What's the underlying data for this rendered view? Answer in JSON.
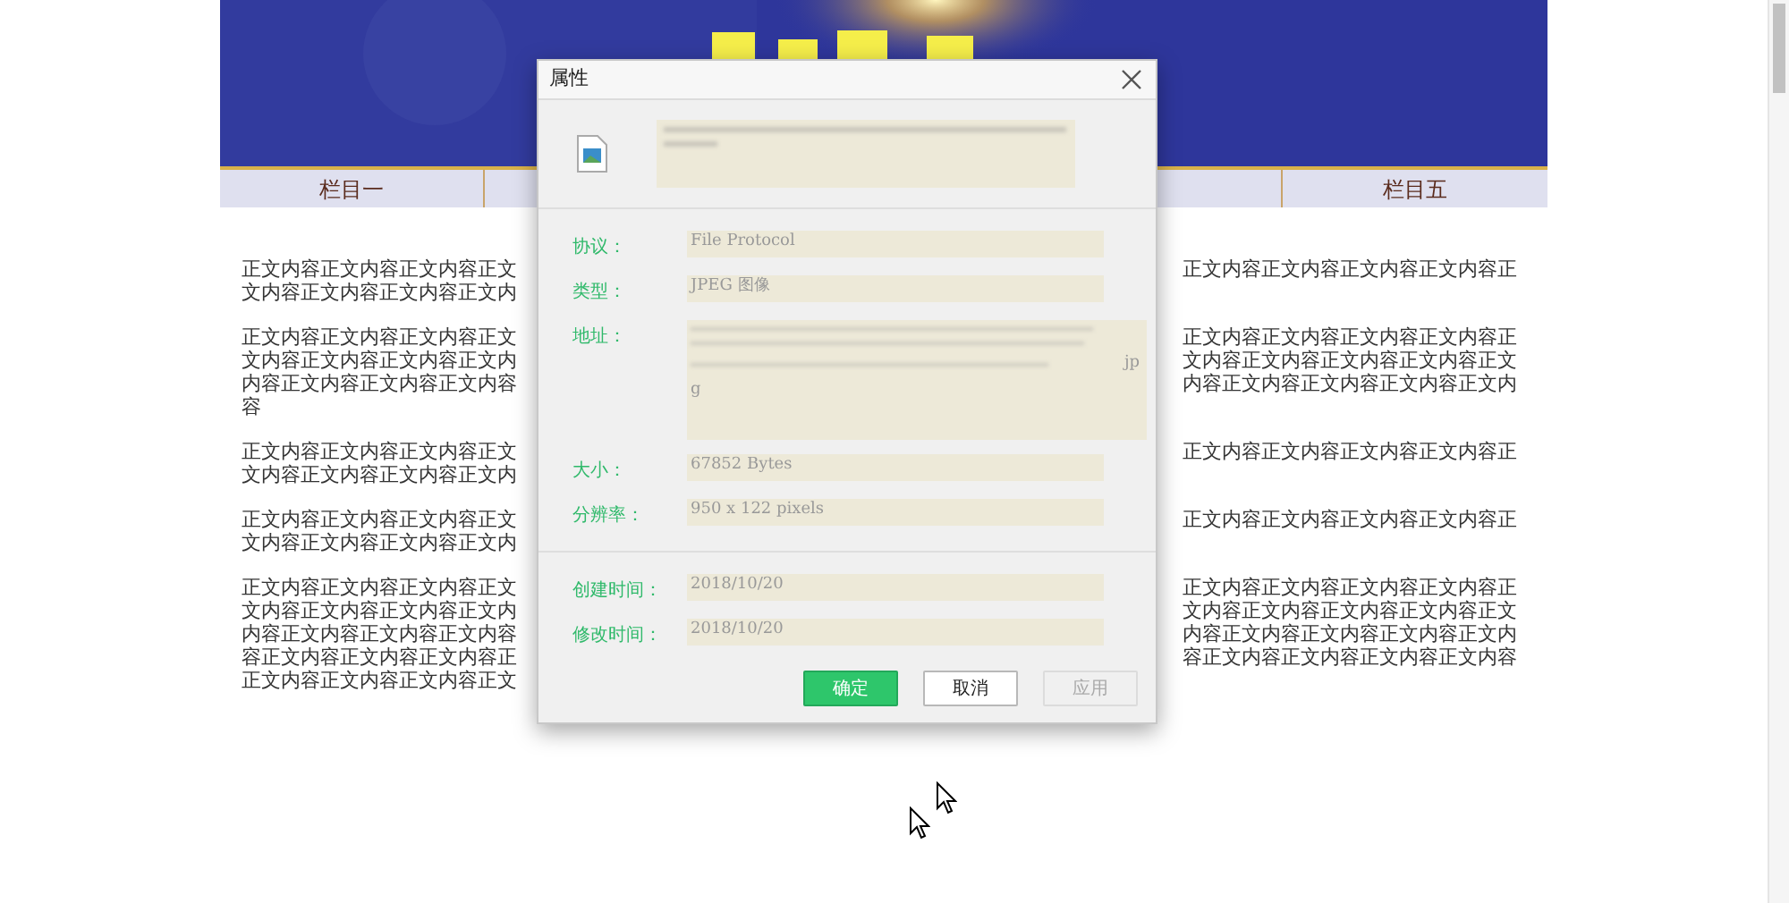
{
  "nav": {
    "items": [
      {
        "label": "栏目一"
      },
      {
        "label": "栏目五"
      }
    ]
  },
  "body": {
    "paragraphs": [
      {
        "lines": [
          {
            "left": "正文内容正文内容正文内容正文",
            "right": "正文内容正文内容正文内容正文内容正"
          },
          {
            "left": "文内容正文内容正文内容正文内"
          }
        ]
      },
      {
        "lines": [
          {
            "left": "正文内容正文内容正文内容正文",
            "right": "正文内容正文内容正文内容正文内容正"
          },
          {
            "left": "文内容正文内容正文内容正文内",
            "right": "文内容正文内容正文内容正文内容正文"
          },
          {
            "left": "内容正文内容正文内容正文内容",
            "right": "内容正文内容正文内容正文内容正文内"
          },
          {
            "left": "容"
          }
        ]
      },
      {
        "lines": [
          {
            "left": "正文内容正文内容正文内容正文",
            "right": "正文内容正文内容正文内容正文内容正"
          },
          {
            "left": "文内容正文内容正文内容正文内"
          }
        ]
      },
      {
        "lines": [
          {
            "left": "正文内容正文内容正文内容正文",
            "right": "正文内容正文内容正文内容正文内容正"
          },
          {
            "left": "文内容正文内容正文内容正文内"
          }
        ]
      },
      {
        "lines": [
          {
            "left": "正文内容正文内容正文内容正文",
            "right": "正文内容正文内容正文内容正文内容正"
          },
          {
            "left": "文内容正文内容正文内容正文内",
            "right": "文内容正文内容正文内容正文内容正文"
          },
          {
            "left": "内容正文内容正文内容正文内容",
            "right": "内容正文内容正文内容正文内容正文内"
          },
          {
            "left": "容正文内容正文内容正文内容正",
            "right": "容正文内容正文内容正文内容正文内容"
          },
          {
            "left": "正文内容正文内容正文内容正文"
          }
        ]
      }
    ]
  },
  "dialog": {
    "title": "属性",
    "groups": [
      [
        {
          "label": "协议：",
          "value": "File Protocol",
          "kind": "text"
        },
        {
          "label": "类型：",
          "value": "JPEG 图像",
          "kind": "text"
        },
        {
          "label": "地址：",
          "value_lines": [
            "jp",
            "g"
          ],
          "kind": "address"
        },
        {
          "label": "大小：",
          "value": "67852 Bytes",
          "kind": "text"
        },
        {
          "label": "分辨率：",
          "value": "950 x 122 pixels",
          "kind": "text"
        }
      ],
      [
        {
          "label": "创建时间：",
          "value": "2018/10/20",
          "kind": "text"
        },
        {
          "label": "修改时间：",
          "value": "2018/10/20",
          "kind": "text"
        }
      ]
    ],
    "buttons": [
      {
        "label": "确定",
        "kind": "primary",
        "disabled": false
      },
      {
        "label": "取消",
        "kind": "default",
        "disabled": false
      },
      {
        "label": "应用",
        "kind": "default",
        "disabled": true
      }
    ]
  }
}
